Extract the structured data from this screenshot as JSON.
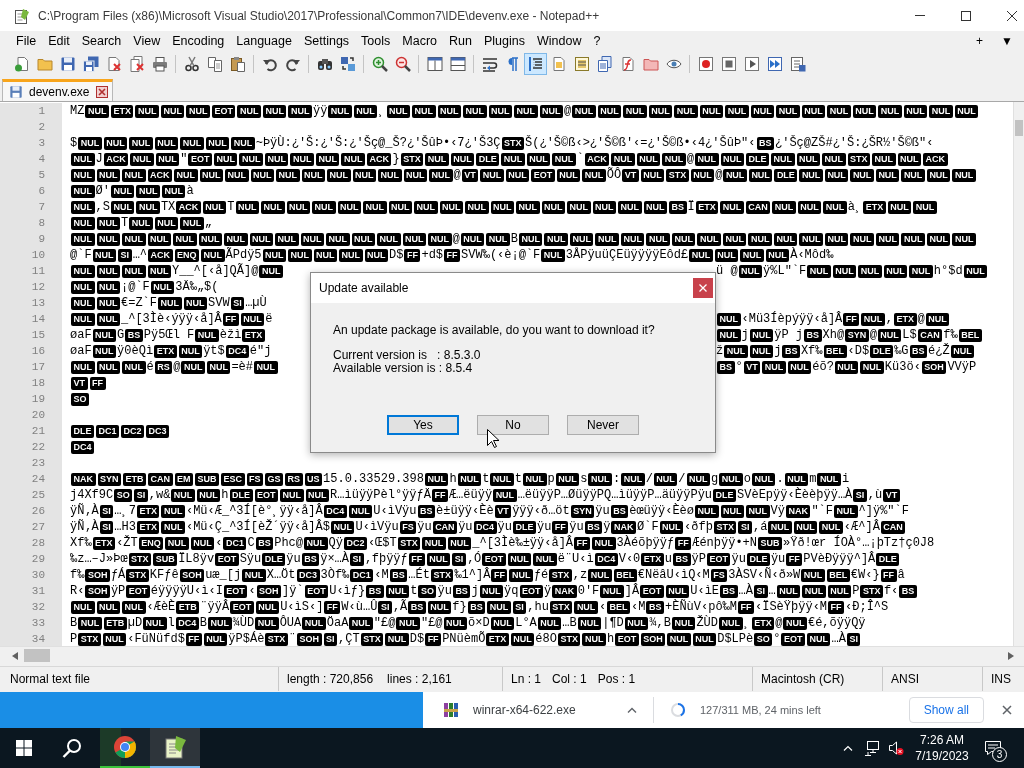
{
  "window": {
    "title": "C:\\Program Files (x86)\\Microsoft Visual Studio\\2017\\Professional\\Common7\\IDE\\devenv.exe - Notepad++"
  },
  "menu": [
    "File",
    "Edit",
    "Search",
    "View",
    "Encoding",
    "Language",
    "Settings",
    "Tools",
    "Macro",
    "Run",
    "Plugins",
    "Window",
    "?"
  ],
  "menu_extras": [
    "+",
    "▼"
  ],
  "toolbar": [
    {
      "pressed": false
    },
    {
      "pressed": false
    },
    {
      "pressed": false
    },
    {
      "pressed": false
    },
    {
      "pressed": false
    },
    {
      "pressed": false
    },
    {
      "pressed": false
    },
    {
      "pressed": false
    },
    {
      "pressed": false
    },
    {
      "pressed": false
    },
    {
      "pressed": false
    },
    {
      "pressed": false
    },
    {
      "pressed": false
    },
    {
      "pressed": false
    },
    {
      "pressed": false
    },
    {
      "pressed": false
    },
    {
      "pressed": false
    },
    {
      "pressed": false
    },
    {
      "pressed": false
    },
    {
      "pressed": false
    },
    {
      "pressed": true
    },
    {
      "pressed": false
    },
    {
      "pressed": false
    },
    {
      "pressed": false
    },
    {
      "pressed": false
    },
    {
      "pressed": false
    },
    {
      "pressed": false
    },
    {
      "pressed": false
    },
    {
      "pressed": false
    },
    {
      "pressed": false
    },
    {
      "pressed": false
    },
    {
      "pressed": false
    }
  ],
  "tabs": [
    {
      "label": "devenv.exe",
      "selected": true
    }
  ],
  "editor": {
    "lines": [
      {
        "number": "1",
        "runs": [
          {
            "text": "MZ",
            "controls": [
              "NUL",
              "ETX",
              "NUL",
              "NUL",
              "NUL",
              "EOT",
              "NUL",
              "NUL",
              "NUL"
            ]
          },
          {
            "text": "ÿÿ",
            "controls": [
              "NUL",
              "NUL"
            ]
          },
          {
            "text": "¸",
            "controls": [
              "NUL",
              "NUL",
              "NUL",
              "NUL",
              "NUL",
              "NUL",
              "NUL"
            ]
          },
          {
            "text": "@",
            "controls": [
              "NUL",
              "NUL",
              "NUL",
              "NUL",
              "NUL",
              "NUL",
              "NUL",
              "NUL",
              "NUL",
              "NUL",
              "NUL",
              "NUL",
              "NUL",
              "NUL",
              "NUL",
              "NUL"
            ]
          }
        ]
      },
      {
        "number": "2"
      },
      {
        "number": "3",
        "runs": [
          {
            "text": "$",
            "controls": [
              "NUL",
              "NUL",
              "NUL",
              "NUL",
              "NUL",
              "NUL",
              "NUL"
            ]
          },
          {
            "text": "~ÞÿÙ:¿'Š:¿'Š:¿'Šç@_Š?¿'ŠûÞ•‹7¿'Š3Ç",
            "controls": [
              "STX"
            ]
          },
          {
            "text": "Š(¿'Š©ß‹>¿'Š©ß'‹=¿'Š©ß•‹4¿'ŠûÞ\"‹",
            "controls": [
              "BS"
            ]
          },
          {
            "text": "¿'Šç@ZŠ#¿'Š:¿ŠR½'Š©ß\"‹"
          }
        ]
      },
      {
        "number": "4",
        "runs": [
          {
            "controls": [
              "NUL"
            ]
          },
          {
            "text": "J",
            "controls": [
              "ACK",
              "NUL",
              "NUL"
            ]
          },
          {
            "text": "\"",
            "controls": [
              "EOT",
              "NUL",
              "NUL",
              "NUL",
              "NUL",
              "NUL",
              "NUL",
              "ACK"
            ]
          },
          {
            "text": "}",
            "controls": [
              "STX",
              "NUL",
              "NUL",
              "DLE",
              "NUL",
              "NUL",
              "NUL"
            ]
          },
          {
            "text": "`",
            "controls": [
              "ACK",
              "NUL",
              "NUL",
              "NUL"
            ]
          },
          {
            "text": "@",
            "controls": [
              "NUL",
              "NUL",
              "DLE",
              "NUL",
              "NUL",
              "NUL",
              "STX",
              "NUL",
              "NUL",
              "ACK"
            ]
          }
        ]
      },
      {
        "number": "5",
        "runs": [
          {
            "controls": [
              "NUL",
              "NUL",
              "NUL",
              "ACK",
              "NUL",
              "NUL",
              "NUL",
              "NUL",
              "NUL",
              "NUL",
              "NUL",
              "NUL",
              "NUL",
              "NUL",
              "NUL"
            ]
          },
          {
            "text": "@",
            "controls": [
              "VT",
              "NUL",
              "NUL",
              "EOT",
              "NUL",
              "NUL"
            ]
          },
          {
            "text": "ÕÔ",
            "controls": [
              "VT",
              "NUL",
              "STX",
              "NUL"
            ]
          },
          {
            "text": "@",
            "controls": [
              "NUL",
              "NUL",
              "DLE",
              "NUL",
              "NUL",
              "NUL",
              "NUL",
              "NUL",
              "NUL",
              "NUL"
            ]
          }
        ]
      },
      {
        "number": "6",
        "runs": [
          {
            "controls": [
              "NUL"
            ]
          },
          {
            "text": "Ø'",
            "controls": [
              "NUL",
              "NUL",
              "NUL"
            ]
          },
          {
            "text": "à"
          }
        ]
      },
      {
        "number": "7",
        "runs": [
          {
            "controls": [
              "NUL"
            ]
          },
          {
            "text": ",S",
            "controls": [
              "NUL",
              "NUL"
            ]
          },
          {
            "text": "TX",
            "controls": [
              "ACK",
              "NUL"
            ]
          },
          {
            "text": "T",
            "controls": [
              "NUL",
              "NUL",
              "NUL",
              "NUL",
              "NUL",
              "NUL",
              "NUL",
              "NUL",
              "NUL",
              "NUL",
              "NUL",
              "NUL",
              "NUL",
              "NUL",
              "NUL",
              "NUL",
              "NUL",
              "BS"
            ]
          },
          {
            "text": "Ï",
            "controls": [
              "ETX",
              "NUL",
              "CAN",
              "NUL",
              "NUL",
              "NUL"
            ]
          },
          {
            "text": "à¸",
            "controls": [
              "ETX",
              "NUL",
              "NUL"
            ]
          }
        ]
      },
      {
        "number": "8",
        "runs": [
          {
            "controls": [
              "NUL",
              "NUL"
            ]
          },
          {
            "text": "T",
            "controls": [
              "NUL",
              "NUL",
              "NUL"
            ]
          },
          {
            "text": "„"
          }
        ]
      },
      {
        "number": "9",
        "runs": [
          {
            "controls": [
              "NUL",
              "NUL",
              "NUL",
              "NUL",
              "NUL",
              "NUL",
              "NUL",
              "NUL",
              "NUL",
              "NUL",
              "NUL",
              "NUL",
              "NUL",
              "NUL",
              "NUL"
            ]
          },
          {
            "text": "@",
            "controls": [
              "NUL",
              "NUL"
            ]
          },
          {
            "text": "B",
            "controls": [
              "NUL",
              "NUL",
              "NUL",
              "NUL",
              "NUL",
              "NUL",
              "NUL",
              "NUL",
              "NUL",
              "NUL",
              "NUL",
              "NUL",
              "NUL",
              "NUL",
              "NUL",
              "NUL",
              "NUL",
              "NUL"
            ]
          }
        ]
      },
      {
        "number": "10",
        "runs": [
          {
            "text": "@`F",
            "controls": [
              "NUL",
              "SI"
            ]
          },
          {
            "text": "…^",
            "controls": [
              "ACK",
              "ENQ",
              "NUL"
            ]
          },
          {
            "text": "ÃPdÿ5",
            "controls": [
              "NUL",
              "NUL",
              "NUL",
              "NUL",
              "NUL"
            ]
          },
          {
            "text": "D$",
            "controls": [
              "FF"
            ]
          },
          {
            "text": "+d$",
            "controls": [
              "FF"
            ]
          },
          {
            "text": "SVW‰(‹è¡@`F",
            "controls": [
              "NUL"
            ]
          },
          {
            "text": "3ÅPÿuüÇEüÿÿÿÿEôd£",
            "controls": [
              "NUL",
              "NUL",
              "NUL",
              "NUL"
            ]
          },
          {
            "text": "À‹Môd‰"
          }
        ]
      },
      {
        "number": "11",
        "runs": [
          {
            "controls": [
              "NUL",
              "NUL",
              "NUL",
              "NUL"
            ]
          },
          {
            "text": "Y__^[‹å]QÃ]@",
            "controls": [
              "NUL"
            ]
          }
        ],
        "runs_right_of_dialog": [
          {
            "text": "ü @",
            "controls": [
              "NUL"
            ]
          },
          {
            "text": "ÿ%L\"`F",
            "controls": [
              "NUL",
              "NUL",
              "NUL",
              "NUL",
              "NUL"
            ]
          },
          {
            "text": "h°$d",
            "controls": [
              "NUL"
            ]
          }
        ]
      },
      {
        "number": "12",
        "runs": [
          {
            "controls": [
              "NUL",
              "NUL"
            ]
          },
          {
            "text": "¡@`F",
            "controls": [
              "NUL"
            ]
          },
          {
            "text": "3Ä‰„$("
          }
        ]
      },
      {
        "number": "13",
        "runs": [
          {
            "controls": [
              "NUL",
              "NUL"
            ]
          },
          {
            "text": "€=Z`F",
            "controls": [
              "NUL",
              "NUL"
            ]
          },
          {
            "text": "SVW",
            "controls": [
              "SI"
            ]
          },
          {
            "text": "…µÙ"
          }
        ]
      },
      {
        "number": "14",
        "runs": [
          {
            "controls": [
              "NUL",
              "NUL"
            ]
          },
          {
            "text": "_^[3Ìè‹ýÿÿ‹å]Â",
            "controls": [
              "FF",
              "NUL"
            ]
          },
          {
            "text": "ë"
          }
        ],
        "runs_right_of_dialog": [
          {
            "controls": [
              "NUL"
            ]
          },
          {
            "text": "‹Mü3Íèpýÿÿ‹å]Â",
            "controls": [
              "FF",
              "NUL"
            ]
          },
          {
            "text": ",",
            "controls": [
              "ETX"
            ]
          },
          {
            "text": "@",
            "controls": [
              "NUL"
            ]
          }
        ]
      },
      {
        "number": "15",
        "runs": [
          {
            "text": "øaF",
            "controls": [
              "NUL"
            ]
          },
          {
            "text": "G",
            "controls": [
              "BS"
            ]
          },
          {
            "text": "Pÿ5Œl F",
            "controls": [
              "NUL"
            ]
          },
          {
            "text": "èžì",
            "controls": [
              "ETX"
            ]
          }
        ],
        "runs_right_of_dialog": [
          {
            "controls": [
              "NUL"
            ]
          },
          {
            "text": "j",
            "controls": [
              "NUL"
            ]
          },
          {
            "text": "ÿP j",
            "controls": [
              "BS"
            ]
          },
          {
            "text": "Xh@",
            "controls": [
              "SYN"
            ]
          },
          {
            "text": "@",
            "controls": [
              "NUL"
            ]
          },
          {
            "text": "L$",
            "controls": [
              "CAN"
            ]
          },
          {
            "text": "f‰",
            "controls": [
              "BEL"
            ]
          }
        ]
      },
      {
        "number": "16",
        "runs": [
          {
            "text": "øaF",
            "controls": [
              "NUL"
            ]
          },
          {
            "text": "ÿ0èQì",
            "controls": [
              "ETX",
              "NUL"
            ]
          },
          {
            "text": "ÿt$",
            "controls": [
              "DC4"
            ]
          },
          {
            "text": "é\"j"
          }
        ],
        "runs_right_of_dialog": [
          {
            "text": "ž",
            "controls": [
              "NUL",
              "NUL"
            ]
          },
          {
            "text": "j",
            "controls": [
              "BS"
            ]
          },
          {
            "text": "Xf‰",
            "controls": [
              "BEL"
            ]
          },
          {
            "text": "‹D$",
            "controls": [
              "DLE"
            ]
          },
          {
            "text": "‰G",
            "controls": [
              "BS"
            ]
          },
          {
            "text": "é¿Ž",
            "controls": [
              "NUL"
            ]
          }
        ]
      },
      {
        "number": "17",
        "runs": [
          {
            "controls": [
              "NUL",
              "NUL",
              "NUL"
            ]
          },
          {
            "text": "é",
            "controls": [
              "RS"
            ]
          },
          {
            "text": "@",
            "controls": [
              "NUL",
              "NUL"
            ]
          },
          {
            "text": "=è#",
            "controls": [
              "NUL"
            ]
          }
        ],
        "runs_right_of_dialog": [
          {
            "controls": [
              "BS"
            ]
          },
          {
            "text": "°",
            "controls": [
              "VT",
              "NUL",
              "NUL"
            ]
          },
          {
            "text": "éõ?",
            "controls": [
              "NUL",
              "NUL"
            ]
          },
          {
            "text": "Kü3ö‹",
            "controls": [
              "SOH"
            ]
          },
          {
            "text": "VVÿP"
          }
        ]
      },
      {
        "number": "18",
        "runs": [
          {
            "controls": [
              "VT",
              "FF"
            ]
          }
        ]
      },
      {
        "number": "19",
        "runs": [
          {
            "controls": [
              "SO"
            ]
          }
        ]
      },
      {
        "number": "20"
      },
      {
        "number": "21",
        "runs": [
          {
            "controls": [
              "DLE",
              "DC1",
              "DC2",
              "DC3"
            ]
          }
        ]
      },
      {
        "number": "22",
        "runs": [
          {
            "controls": [
              "DC4"
            ]
          }
        ]
      },
      {
        "number": "23"
      },
      {
        "number": "24",
        "runs": [
          {
            "controls": [
              "NAK",
              "SYN",
              "ETB",
              "CAN",
              "EM",
              "SUB",
              "ESC",
              "FS",
              "GS",
              "RS",
              "US"
            ]
          },
          {
            "text": "15.0.33529.398",
            "controls": [
              "NUL"
            ]
          },
          {
            "text": "h",
            "controls": [
              "NUL"
            ]
          },
          {
            "text": "t",
            "controls": [
              "NUL"
            ]
          },
          {
            "text": "t",
            "controls": [
              "NUL"
            ]
          },
          {
            "text": "p",
            "controls": [
              "NUL"
            ]
          },
          {
            "text": "s",
            "controls": [
              "NUL"
            ]
          },
          {
            "text": ":",
            "controls": [
              "NUL"
            ]
          },
          {
            "text": "/",
            "controls": [
              "NUL"
            ]
          },
          {
            "text": "/",
            "controls": [
              "NUL"
            ]
          },
          {
            "text": "g",
            "controls": [
              "NUL"
            ]
          },
          {
            "text": "o",
            "controls": [
              "NUL"
            ]
          },
          {
            "text": ".",
            "controls": [
              "NUL"
            ]
          },
          {
            "text": "m",
            "controls": [
              "NUL"
            ]
          },
          {
            "text": "i"
          }
        ]
      },
      {
        "number": "25",
        "runs": [
          {
            "text": "j4Xf9C",
            "controls": [
              "SO",
              "SI"
            ]
          },
          {
            "text": ",w&",
            "controls": [
              "NUL",
              "NUL"
            ]
          },
          {
            "text": "h",
            "controls": [
              "DLE",
              "EOT",
              "NUL",
              "NUL"
            ]
          },
          {
            "text": "R…ìüÿÿPèl°ÿÿƒÄ",
            "controls": [
              "FF"
            ]
          },
          {
            "text": "Æ…ëüÿÿ",
            "controls": [
              "NUL"
            ]
          },
          {
            "text": "…ëüÿÿP…ØüÿÿPQ…ìüÿÿP…äüÿÿPÿu",
            "controls": [
              "DLE"
            ]
          },
          {
            "text": "SVèEpÿÿ‹Èèèþÿÿ…À",
            "controls": [
              "SI"
            ]
          },
          {
            "text": ",ù",
            "controls": [
              "VT"
            ]
          }
        ]
      },
      {
        "number": "26",
        "runs": [
          {
            "text": "ÿÑ‚À",
            "controls": [
              "SI"
            ]
          },
          {
            "text": "…¸7",
            "controls": [
              "ETX",
              "NUL"
            ]
          },
          {
            "text": "‹Mü‹Æ_^3Í[è°¸ÿÿ‹å]Â",
            "controls": [
              "DC4",
              "NUL"
            ]
          },
          {
            "text": "U‹ìVÿu",
            "controls": [
              "BS"
            ]
          },
          {
            "text": "è±üÿÿ‹Èè",
            "controls": [
              "VT"
            ]
          },
          {
            "text": "ÿÿÿ‹ð…öt",
            "controls": [
              "SYN"
            ]
          },
          {
            "text": "ÿu",
            "controls": [
              "BS"
            ]
          },
          {
            "text": "èœüÿÿ‹Èèø",
            "controls": [
              "NUL",
              "NUL",
              "NUL"
            ]
          },
          {
            "text": "Vÿ",
            "controls": [
              "NAK"
            ]
          },
          {
            "text": "\"`F",
            "controls": [
              "NUL"
            ]
          },
          {
            "text": "^]ÿ%\"`F"
          }
        ]
      },
      {
        "number": "27",
        "runs": [
          {
            "text": "ÿÑ‚À",
            "controls": [
              "SI"
            ]
          },
          {
            "text": "…H3",
            "controls": [
              "ETX",
              "NUL"
            ]
          },
          {
            "text": "‹Mü‹Ç_^3Í[èŽ´ÿÿ‹å]Â$",
            "controls": [
              "NUL"
            ]
          },
          {
            "text": "U‹ìVÿu",
            "controls": [
              "FS"
            ]
          },
          {
            "text": "ÿu",
            "controls": [
              "CAN"
            ]
          },
          {
            "text": "ÿu",
            "controls": [
              "DC4"
            ]
          },
          {
            "text": "ÿu",
            "controls": [
              "DLE"
            ]
          },
          {
            "text": "ÿu",
            "controls": [
              "FF"
            ]
          },
          {
            "text": "ÿu",
            "controls": [
              "BS"
            ]
          },
          {
            "text": "ÿ",
            "controls": [
              "NAK"
            ]
          },
          {
            "text": "Ø`F",
            "controls": [
              "NUL"
            ]
          },
          {
            "text": "‹ðfþ",
            "controls": [
              "STX",
              "SI"
            ]
          },
          {
            "text": ",á",
            "controls": [
              "NUL",
              "NUL",
              "NUL"
            ]
          },
          {
            "text": "‹Æ^]Â",
            "controls": [
              "CAN"
            ]
          }
        ]
      },
      {
        "number": "28",
        "runs": [
          {
            "text": "Xf‰",
            "controls": [
              "ETX"
            ]
          },
          {
            "text": "‹ŽT",
            "controls": [
              "ENQ",
              "NUL",
              "NUL"
            ]
          },
          {
            "text": "‹",
            "controls": [
              "DC1"
            ]
          },
          {
            "text": "C",
            "controls": [
              "BS"
            ]
          },
          {
            "text": "Phc@",
            "controls": [
              "NUL"
            ]
          },
          {
            "text": "Qÿ",
            "controls": [
              "DC2"
            ]
          },
          {
            "text": "‹Œ$T",
            "controls": [
              "STX",
              "NUL",
              "NUL"
            ]
          },
          {
            "text": "_^[3Ìè‰±ÿÿ‹å]Â",
            "controls": [
              "FF",
              "NUL"
            ]
          },
          {
            "text": "3Àéõþÿÿƒ",
            "controls": [
              "FF"
            ]
          },
          {
            "text": "Æénþÿÿ•+N",
            "controls": [
              "SUB"
            ]
          },
          {
            "text": "»Ÿð!œr ÍOÀ°…¡þTz†ç0J8"
          }
        ]
      },
      {
        "number": "29",
        "runs": [
          {
            "text": "‰z…–J»Þœ",
            "controls": [
              "STX",
              "SUB"
            ]
          },
          {
            "text": "ÏL8ÿv",
            "controls": [
              "EOT"
            ]
          },
          {
            "text": "Sÿu",
            "controls": [
              "DLE"
            ]
          },
          {
            "text": "ÿu",
            "controls": [
              "BS"
            ]
          },
          {
            "text": "ÿ×…À",
            "controls": [
              "SI"
            ]
          },
          {
            "text": "‚fþÿÿƒ",
            "controls": [
              "FF",
              "NUL",
              "SI"
            ]
          },
          {
            "text": "‚Ó",
            "controls": [
              "EOT",
              "NUL",
              "NUL"
            ]
          },
          {
            "text": "ë¨U‹ì",
            "controls": [
              "DC4"
            ]
          },
          {
            "text": "V‹0",
            "controls": [
              "ETX"
            ]
          },
          {
            "text": "u",
            "controls": [
              "BS"
            ]
          },
          {
            "text": "ÿP",
            "controls": [
              "EOT"
            ]
          },
          {
            "text": "ÿu",
            "controls": [
              "DLE"
            ]
          },
          {
            "text": "ÿu",
            "controls": [
              "FF"
            ]
          },
          {
            "text": "PVèÐÿÿÿ^]Â",
            "controls": [
              "DLE"
            ]
          }
        ]
      },
      {
        "number": "30",
        "runs": [
          {
            "text": "f‰",
            "controls": [
              "SOH"
            ]
          },
          {
            "text": "ƒÁ",
            "controls": [
              "STX"
            ]
          },
          {
            "text": "KFƒê",
            "controls": [
              "SOH"
            ]
          },
          {
            "text": "uæ_[j",
            "controls": [
              "NUL"
            ]
          },
          {
            "text": "X…Öt",
            "controls": [
              "DC3"
            ]
          },
          {
            "text": "3Òf‰",
            "controls": [
              "DC1"
            ]
          },
          {
            "text": "‹M",
            "controls": [
              "BS"
            ]
          },
          {
            "text": "…Ét",
            "controls": [
              "STX"
            ]
          },
          {
            "text": "‰1^]Â",
            "controls": [
              "FF",
              "NUL"
            ]
          },
          {
            "text": "ƒé",
            "controls": [
              "STX"
            ]
          },
          {
            "text": ",z",
            "controls": [
              "NUL",
              "BEL"
            ]
          },
          {
            "text": "€NëâU‹ìQ‹M",
            "controls": [
              "FS"
            ]
          },
          {
            "text": "3ÀSV‹Ñ‹ð»W",
            "controls": [
              "NUL",
              "BEL"
            ]
          },
          {
            "text": "€W‹}",
            "controls": [
              "FF"
            ]
          },
          {
            "text": "â"
          }
        ]
      },
      {
        "number": "31",
        "runs": [
          {
            "text": "R‹",
            "controls": [
              "SOH"
            ]
          },
          {
            "text": "ÿP",
            "controls": [
              "EOT"
            ]
          },
          {
            "text": "éÿÿÿÿU‹ì‹I",
            "controls": [
              "EOT"
            ]
          },
          {
            "text": "‹",
            "controls": [
              "SOH"
            ]
          },
          {
            "text": "]ÿ`",
            "controls": [
              "EOT"
            ]
          },
          {
            "text": "U‹ìƒ}",
            "controls": [
              "BS",
              "NUL"
            ]
          },
          {
            "text": "t",
            "controls": [
              "SO"
            ]
          },
          {
            "text": "ÿu",
            "controls": [
              "BS"
            ]
          },
          {
            "text": "j",
            "controls": [
              "NUL"
            ]
          },
          {
            "text": "ÿq",
            "controls": [
              "EOT"
            ]
          },
          {
            "text": "ÿ",
            "controls": [
              "NAK"
            ]
          },
          {
            "text": "0'F",
            "controls": [
              "NUL"
            ]
          },
          {
            "text": "]Â",
            "controls": [
              "EOT",
              "NUL"
            ]
          },
          {
            "text": "U‹ìE",
            "controls": [
              "BS"
            ]
          },
          {
            "text": "…À",
            "controls": [
              "SI"
            ]
          },
          {
            "text": "…",
            "controls": [
              "NUL",
              "NUL",
              "NUL"
            ]
          },
          {
            "text": "P",
            "controls": [
              "STX"
            ]
          },
          {
            "text": "f‹",
            "controls": [
              "BS"
            ]
          }
        ]
      },
      {
        "number": "32",
        "runs": [
          {
            "controls": [
              "NUL",
              "NUL",
              "NUL"
            ]
          },
          {
            "text": "‹ÆèÈ",
            "controls": [
              "ETB"
            ]
          },
          {
            "text": "¨ÿÿÂ",
            "controls": [
              "EOT",
              "NUL"
            ]
          },
          {
            "text": "U‹ìS‹]",
            "controls": [
              "FF"
            ]
          },
          {
            "text": "W‹ù…Û",
            "controls": [
              "SI"
            ]
          },
          {
            "text": ",Ã",
            "controls": [
              "BS",
              "NUL"
            ]
          },
          {
            "text": "f}",
            "controls": [
              "BS",
              "NUL",
              "SI"
            ]
          },
          {
            "text": ",hu",
            "controls": [
              "STX",
              "NUL"
            ]
          },
          {
            "text": "‹",
            "controls": [
              "BEL"
            ]
          },
          {
            "text": "‹M",
            "controls": [
              "BS"
            ]
          },
          {
            "text": "+ÈÑùV‹pô‰M",
            "controls": [
              "FF"
            ]
          },
          {
            "text": "‹ÏSèŸþÿÿ‹M",
            "controls": [
              "FF"
            ]
          },
          {
            "text": "‹Ð;Î^S"
          }
        ]
      },
      {
        "number": "33",
        "runs": [
          {
            "text": "B",
            "controls": [
              "NUL",
              "ETB"
            ]
          },
          {
            "text": "µD",
            "controls": [
              "NUL"
            ]
          },
          {
            "text": "l",
            "controls": [
              "DC4"
            ]
          },
          {
            "text": "B",
            "controls": [
              "NUL"
            ]
          },
          {
            "text": "¾ÙD",
            "controls": [
              "NUL"
            ]
          },
          {
            "text": "ÔUA",
            "controls": [
              "NUL"
            ]
          },
          {
            "text": "ÖaA",
            "controls": [
              "NUL"
            ]
          },
          {
            "text": "\"£@",
            "controls": [
              "NUL"
            ]
          },
          {
            "text": "\"£@",
            "controls": [
              "NUL"
            ]
          },
          {
            "text": "õ×D",
            "controls": [
              "NUL"
            ]
          },
          {
            "text": "L°A",
            "controls": [
              "NUL"
            ]
          },
          {
            "text": "…B",
            "controls": [
              "NUL"
            ]
          },
          {
            "text": "|¶D",
            "controls": [
              "NUL"
            ]
          },
          {
            "text": "¾,B",
            "controls": [
              "NUL"
            ]
          },
          {
            "text": "ŽÙD",
            "controls": [
              "NUL"
            ]
          },
          {
            "text": "¸",
            "controls": [
              "ETX"
            ]
          },
          {
            "text": "@",
            "controls": [
              "NUL"
            ]
          },
          {
            "text": "€é,õÿÿQÿ"
          }
        ]
      },
      {
        "number": "34",
        "runs": [
          {
            "text": "P",
            "controls": [
              "STX",
              "NUL"
            ]
          },
          {
            "text": "‹FüNüfd$",
            "controls": [
              "FF",
              "NUL"
            ]
          },
          {
            "text": "ÿP$Áè",
            "controls": [
              "STX"
            ]
          },
          {
            "text": "¨",
            "controls": [
              "SOH",
              "SI"
            ]
          },
          {
            "text": ",ÇT",
            "controls": [
              "STX",
              "NUL"
            ]
          },
          {
            "text": "D$",
            "controls": [
              "FF"
            ]
          },
          {
            "text": "PNüèmÕ",
            "controls": [
              "ETX",
              "NUL"
            ]
          },
          {
            "text": "é8O",
            "controls": [
              "STX",
              "NUL"
            ]
          },
          {
            "text": "h",
            "controls": [
              "EOT",
              "SOH",
              "NUL",
              "NUL"
            ]
          },
          {
            "text": "D$LPè",
            "controls": [
              "SO"
            ]
          },
          {
            "text": "°",
            "controls": [
              "EOT",
              "NUL"
            ]
          },
          {
            "text": "…À",
            "controls": [
              "SI"
            ]
          }
        ]
      }
    ]
  },
  "status_bar": [
    [
      "Normal text file"
    ],
    [
      "length : 720,856",
      "lines : 2,161"
    ],
    [
      "Ln : 1",
      "Col : 1",
      "Pos : 1"
    ],
    [
      "Macintosh (CR)"
    ],
    [
      "ANSI"
    ],
    [
      "INS"
    ]
  ],
  "dialog": {
    "title": "Update available",
    "message": "An update package is available, do you want to download it?",
    "details": [
      "Current version is   : 8.5.3.0",
      "Available version is : 8.5.4"
    ],
    "buttons": [
      {
        "label": "Yes",
        "focused": true
      },
      {
        "label": "No",
        "focused": false
      },
      {
        "label": "Never",
        "focused": false
      }
    ]
  },
  "downloads": {
    "items": [
      {
        "filename": "winrar-x64-622.exe"
      },
      {
        "status": "127/311 MB, 24 mins left",
        "level": 0.41
      }
    ],
    "show_all": "Show all"
  },
  "taskbar": {
    "apps": [
      {
        "active": false,
        "level": 0.41
      },
      {
        "active": true
      }
    ],
    "clock": {
      "time": "7:26 AM",
      "date": "7/19/2023"
    },
    "notifications": "3"
  }
}
